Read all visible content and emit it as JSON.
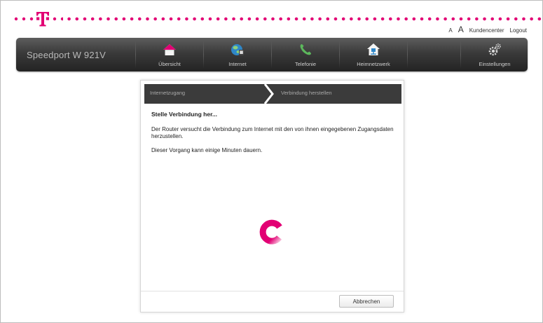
{
  "header": {
    "font_small_label": "A",
    "font_large_label": "A",
    "kundencenter_label": "Kundencenter",
    "logout_label": "Logout",
    "brand_color": "#e20074"
  },
  "nav": {
    "product_name": "Speedport W 921V",
    "items": [
      {
        "label": "Übersicht",
        "icon": "home-icon"
      },
      {
        "label": "Internet",
        "icon": "globe-icon"
      },
      {
        "label": "Telefonie",
        "icon": "phone-icon"
      },
      {
        "label": "Heimnetzwerk",
        "icon": "network-house-icon"
      },
      {
        "label": "Einstellungen",
        "icon": "gears-icon"
      }
    ]
  },
  "wizard": {
    "steps": [
      "Internetzugang",
      "Verbindung herstellen"
    ]
  },
  "dialog": {
    "title": "Stelle Verbindung her...",
    "paragraph1": "Der Router versucht die Verbindung zum Internet mit den von ihnen eingegebenen Zugangsdaten herzustellen.",
    "paragraph2": "Dieser Vorgang kann einige Minuten dauern.",
    "cancel_label": "Abbrechen",
    "spinner_icon": "loading-spinner-icon"
  }
}
